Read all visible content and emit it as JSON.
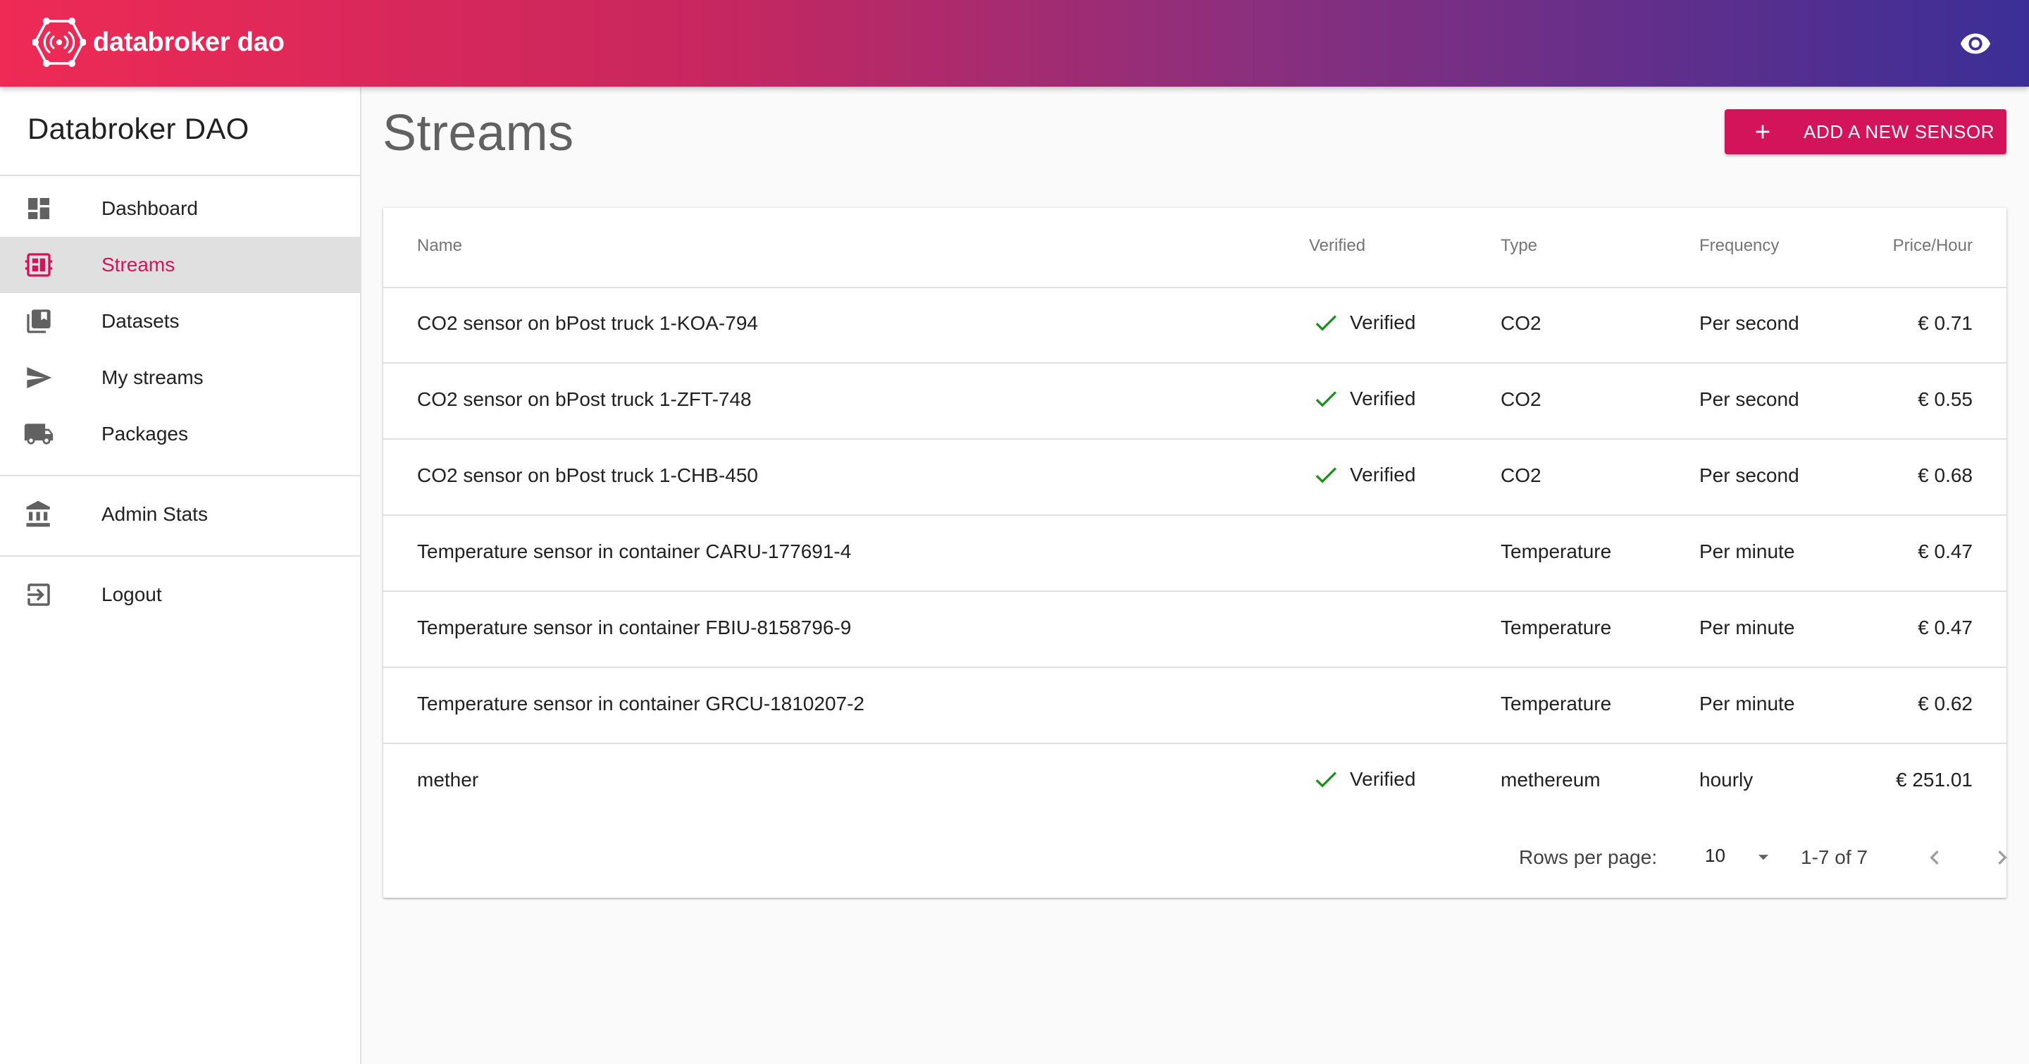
{
  "header": {
    "brand_name": "databroker dao",
    "colors": {
      "gradient_start": "#ee2a55",
      "gradient_end": "#3b2f97"
    },
    "icons": {
      "logo": "databroker-logo-icon",
      "right": "eye-icon"
    }
  },
  "sidebar": {
    "title": "Databroker DAO",
    "items": [
      {
        "label": "Dashboard",
        "icon": "dashboard-icon",
        "active": false
      },
      {
        "label": "Streams",
        "icon": "streams-icon",
        "active": true
      },
      {
        "label": "Datasets",
        "icon": "datasets-icon",
        "active": false
      },
      {
        "label": "My streams",
        "icon": "send-icon",
        "active": false
      },
      {
        "label": "Packages",
        "icon": "truck-icon",
        "active": false
      },
      {
        "label": "Admin Stats",
        "icon": "bank-icon",
        "active": false
      },
      {
        "label": "Logout",
        "icon": "logout-icon",
        "active": false
      }
    ],
    "accent_color": "#d4145a"
  },
  "main": {
    "title": "Streams",
    "add_button": {
      "label": "ADD A NEW SENSOR",
      "icon": "plus-icon",
      "color": "#d4145a"
    },
    "table": {
      "columns": [
        "Name",
        "Verified",
        "Type",
        "Frequency",
        "Price/Hour"
      ],
      "rows": [
        {
          "name": "CO2 sensor on bPost truck 1-KOA-794",
          "verified": "Verified",
          "type": "CO2",
          "frequency": "Per second",
          "price": "€ 0.71"
        },
        {
          "name": "CO2 sensor on bPost truck 1-ZFT-748",
          "verified": "Verified",
          "type": "CO2",
          "frequency": "Per second",
          "price": "€ 0.55"
        },
        {
          "name": "CO2 sensor on bPost truck 1-CHB-450",
          "verified": "Verified",
          "type": "CO2",
          "frequency": "Per second",
          "price": "€ 0.68"
        },
        {
          "name": "Temperature sensor in container CARU-177691-4",
          "verified": "",
          "type": "Temperature",
          "frequency": "Per minute",
          "price": "€ 0.47"
        },
        {
          "name": "Temperature sensor in container FBIU-8158796-9",
          "verified": "",
          "type": "Temperature",
          "frequency": "Per minute",
          "price": "€ 0.47"
        },
        {
          "name": "Temperature sensor in container GRCU-1810207-2",
          "verified": "",
          "type": "Temperature",
          "frequency": "Per minute",
          "price": "€ 0.62"
        },
        {
          "name": "mether",
          "verified": "Verified",
          "type": "methereum",
          "frequency": "hourly",
          "price": "€ 251.01"
        }
      ],
      "verified_color": "#1e8e1e"
    },
    "pagination": {
      "rows_per_page_label": "Rows per page:",
      "rows_per_page_value": "10",
      "range": "1-7 of 7"
    }
  }
}
